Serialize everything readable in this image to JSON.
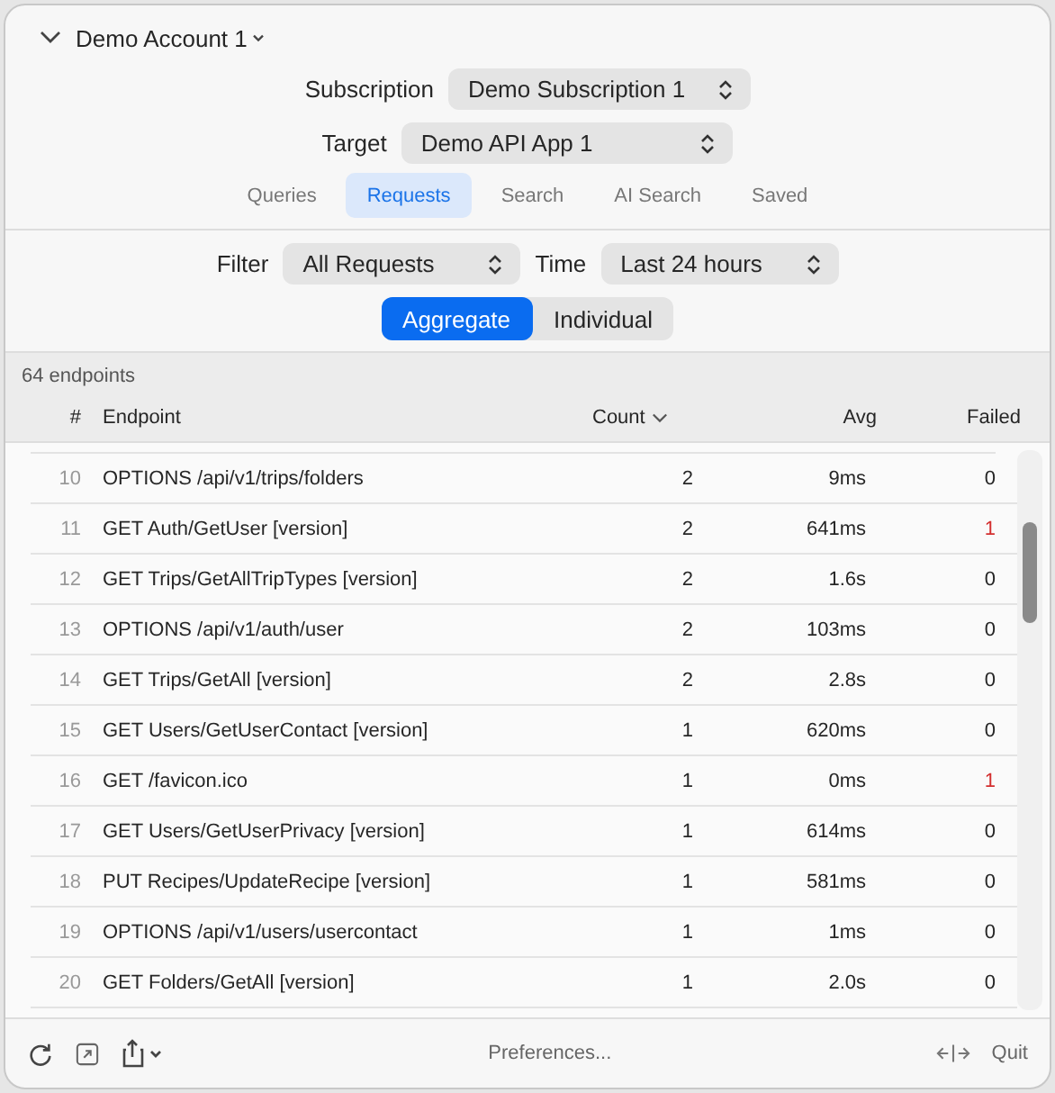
{
  "account": {
    "name": "Demo Account 1",
    "expanded": true
  },
  "selectors": [
    {
      "label": "Subscription",
      "value": "Demo Subscription 1"
    },
    {
      "label": "Target",
      "value": "Demo API App 1"
    }
  ],
  "tabs": [
    {
      "label": "Queries",
      "selected": false
    },
    {
      "label": "Requests",
      "selected": true
    },
    {
      "label": "Search",
      "selected": false
    },
    {
      "label": "AI Search",
      "selected": false
    },
    {
      "label": "Saved",
      "selected": false
    }
  ],
  "filters": [
    {
      "label": "Filter",
      "value": "All Requests"
    },
    {
      "label": "Time",
      "value": "Last 24 hours"
    }
  ],
  "modes": [
    {
      "label": "Aggregate",
      "selected": true
    },
    {
      "label": "Individual",
      "selected": false
    }
  ],
  "table": {
    "summary": "64 endpoints",
    "columns": [
      {
        "label": "#",
        "sorted": false
      },
      {
        "label": "Endpoint",
        "sorted": false
      },
      {
        "label": "Count",
        "sorted": true
      },
      {
        "label": "Avg",
        "sorted": false
      },
      {
        "label": "Failed",
        "sorted": false
      }
    ],
    "rows": [
      {
        "index": "10",
        "endpoint": "OPTIONS /api/v1/trips/folders",
        "count": "2",
        "avg": "9ms",
        "failed": "0",
        "error": false
      },
      {
        "index": "11",
        "endpoint": "GET Auth/GetUser [version]",
        "count": "2",
        "avg": "641ms",
        "failed": "1",
        "error": true
      },
      {
        "index": "12",
        "endpoint": "GET Trips/GetAllTripTypes [version]",
        "count": "2",
        "avg": "1.6s",
        "failed": "0",
        "error": false
      },
      {
        "index": "13",
        "endpoint": "OPTIONS /api/v1/auth/user",
        "count": "2",
        "avg": "103ms",
        "failed": "0",
        "error": false
      },
      {
        "index": "14",
        "endpoint": "GET Trips/GetAll [version]",
        "count": "2",
        "avg": "2.8s",
        "failed": "0",
        "error": false
      },
      {
        "index": "15",
        "endpoint": "GET Users/GetUserContact [version]",
        "count": "1",
        "avg": "620ms",
        "failed": "0",
        "error": false
      },
      {
        "index": "16",
        "endpoint": "GET /favicon.ico",
        "count": "1",
        "avg": "0ms",
        "failed": "1",
        "error": true
      },
      {
        "index": "17",
        "endpoint": "GET Users/GetUserPrivacy [version]",
        "count": "1",
        "avg": "614ms",
        "failed": "0",
        "error": false
      },
      {
        "index": "18",
        "endpoint": "PUT Recipes/UpdateRecipe [version]",
        "count": "1",
        "avg": "581ms",
        "failed": "0",
        "error": false
      },
      {
        "index": "19",
        "endpoint": "OPTIONS /api/v1/users/usercontact",
        "count": "1",
        "avg": "1ms",
        "failed": "0",
        "error": false
      },
      {
        "index": "20",
        "endpoint": "GET Folders/GetAll [version]",
        "count": "1",
        "avg": "2.0s",
        "failed": "0",
        "error": false
      }
    ]
  },
  "footer": {
    "preferences": "Preferences...",
    "quit": "Quit"
  }
}
